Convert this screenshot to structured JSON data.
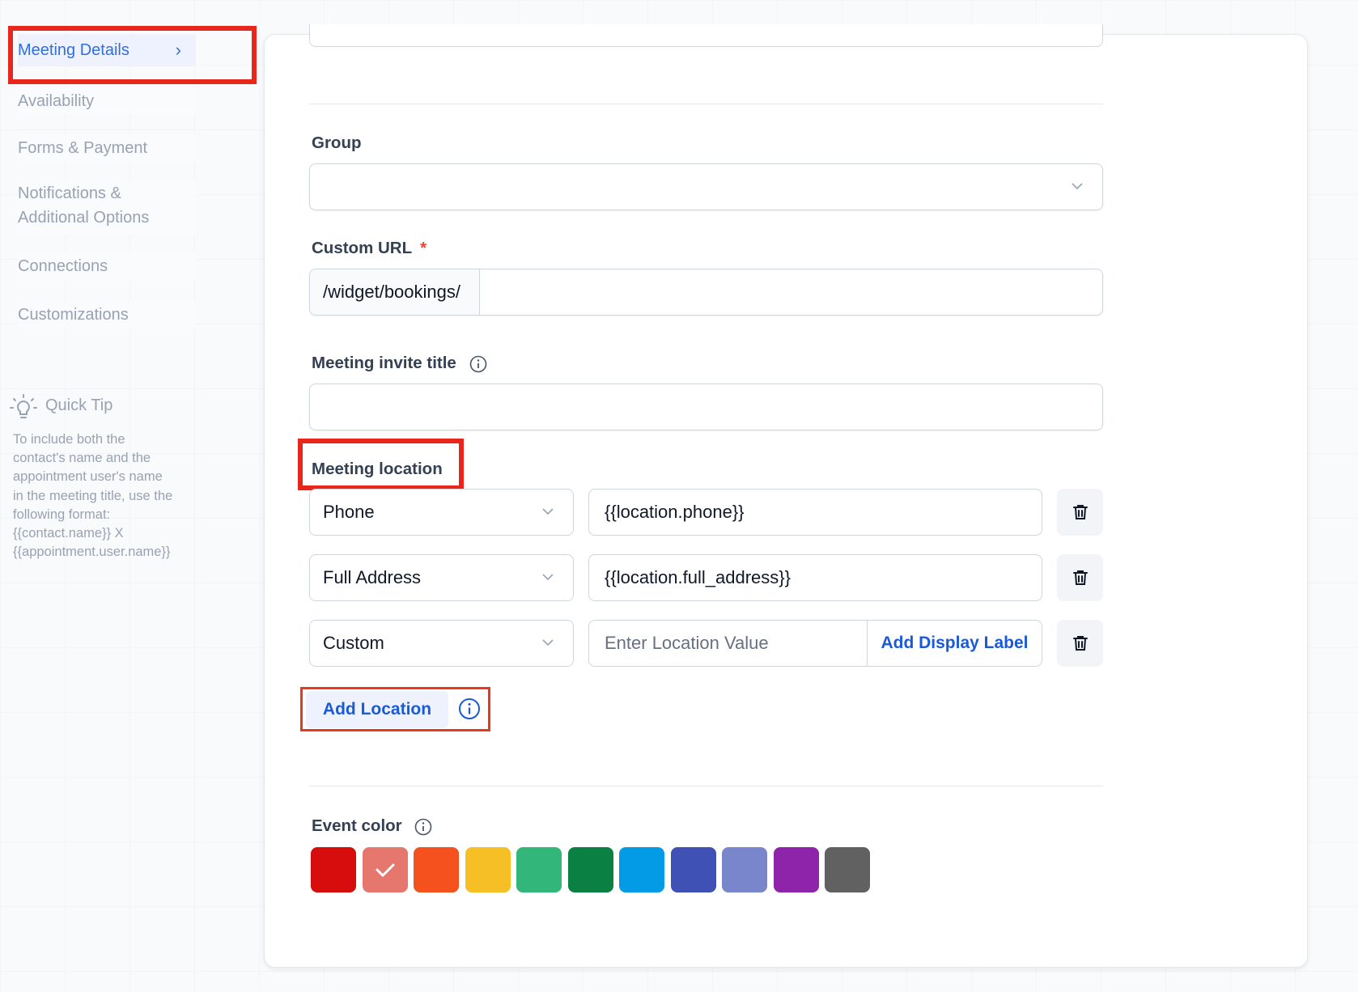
{
  "sidebar": {
    "items": [
      {
        "label": "Meeting Details",
        "active": true
      },
      {
        "label": "Availability"
      },
      {
        "label": "Forms & Payment"
      },
      {
        "label": "Notifications &"
      },
      {
        "label": "Additional Options"
      },
      {
        "label": "Connections"
      },
      {
        "label": "Customizations"
      }
    ],
    "quick_tip": {
      "title": "Quick Tip",
      "lines": [
        "To include both the",
        "contact's name and the",
        "appointment user's name",
        "in the meeting title, use the",
        "following format:",
        "{{contact.name}} X",
        "{{appointment.user.name}}"
      ]
    }
  },
  "form": {
    "group": {
      "label": "Group",
      "value": ""
    },
    "custom_url": {
      "label": "Custom URL",
      "required_mark": "*",
      "prefix": "/widget/bookings/",
      "value": ""
    },
    "invite_title": {
      "label": "Meeting invite title",
      "value": ""
    },
    "location": {
      "label": "Meeting location",
      "rows": [
        {
          "type": "Phone",
          "value": "{{location.phone}}"
        },
        {
          "type": "Full Address",
          "value": "{{location.full_address}}"
        },
        {
          "type": "Custom",
          "placeholder": "Enter Location Value",
          "display_label_button": "Add Display Label"
        }
      ],
      "add_button": "Add Location"
    },
    "event_color": {
      "label": "Event color",
      "colors": [
        "#d70c0c",
        "#e6776f",
        "#f4511e",
        "#f6bf26",
        "#33b679",
        "#0b8043",
        "#039be5",
        "#3f51b5",
        "#7986cb",
        "#8e24aa",
        "#616161"
      ],
      "selected_index": 1
    }
  },
  "icons": {
    "chevron": "chevron-right-icon",
    "dropdown": "chevron-down-icon",
    "info": "info-icon",
    "trash": "trash-icon",
    "tip": "lightbulb-icon",
    "check": "check-icon"
  },
  "colors": {
    "accent": "#2f6fde",
    "highlight": "#e8261c"
  }
}
